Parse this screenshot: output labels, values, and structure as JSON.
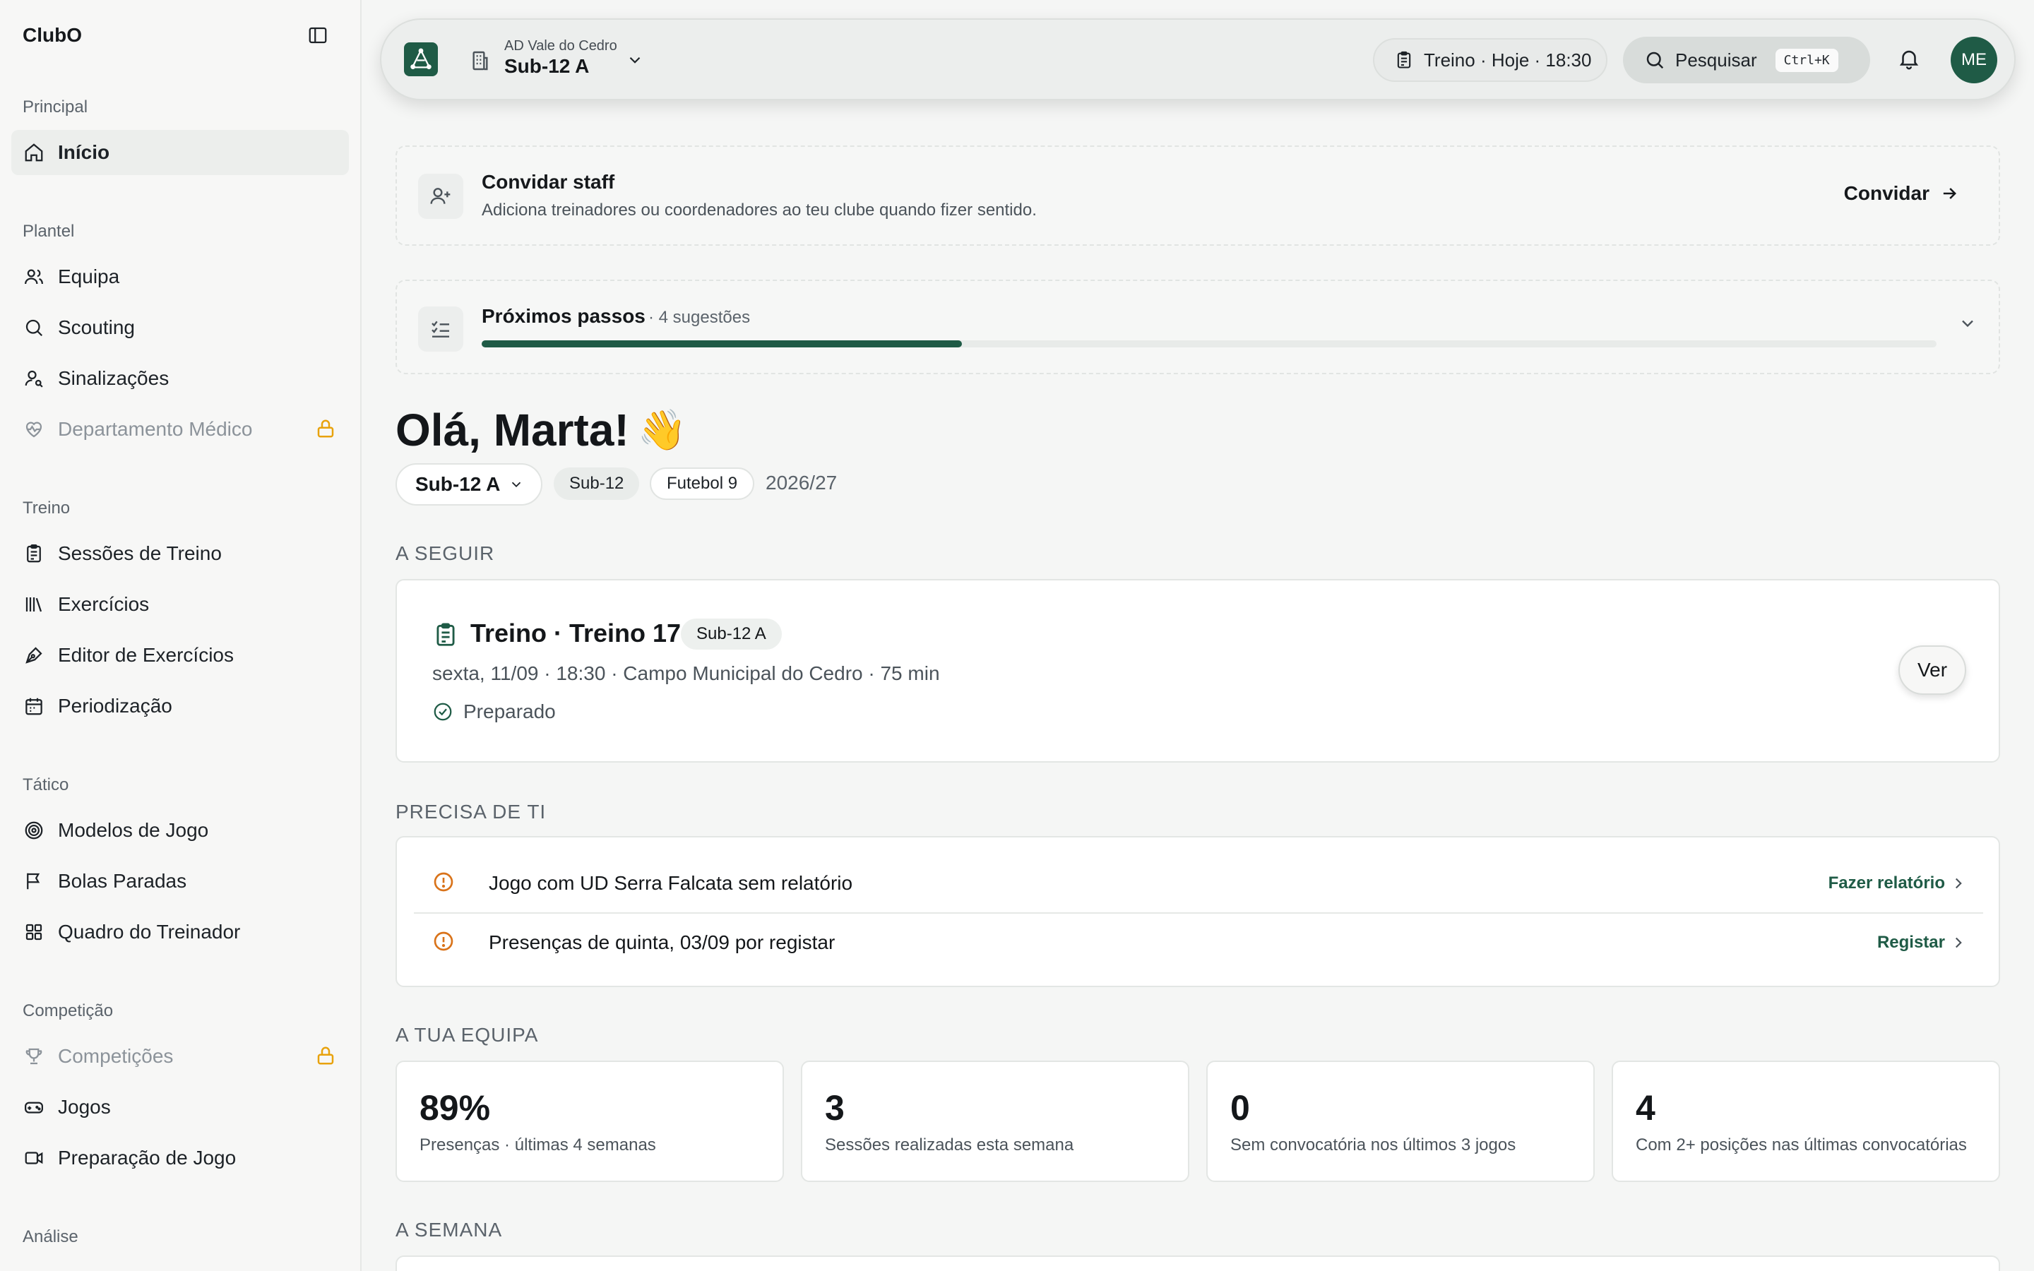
{
  "sidebar": {
    "brand": "ClubO",
    "sections": [
      {
        "label": "Principal"
      },
      {
        "label": "Plantel"
      },
      {
        "label": "Treino"
      },
      {
        "label": "Tático"
      },
      {
        "label": "Competição"
      },
      {
        "label": "Análise"
      }
    ],
    "items": [
      {
        "label": "Início",
        "icon": "home-icon",
        "active": true
      },
      {
        "label": "Equipa",
        "icon": "users-icon"
      },
      {
        "label": "Scouting",
        "icon": "search-icon"
      },
      {
        "label": "Sinalizações",
        "icon": "user-search-icon"
      },
      {
        "label": "Departamento Médico",
        "icon": "heart-pulse-icon",
        "locked": true
      },
      {
        "label": "Sessões de Treino",
        "icon": "clipboard-icon"
      },
      {
        "label": "Exercícios",
        "icon": "library-icon"
      },
      {
        "label": "Editor de Exercícios",
        "icon": "pen-tool-icon"
      },
      {
        "label": "Periodização",
        "icon": "calendar-icon"
      },
      {
        "label": "Modelos de Jogo",
        "icon": "target-icon"
      },
      {
        "label": "Bolas Paradas",
        "icon": "flag-icon"
      },
      {
        "label": "Quadro do Treinador",
        "icon": "grid-icon"
      },
      {
        "label": "Competições",
        "icon": "trophy-icon",
        "locked": true
      },
      {
        "label": "Jogos",
        "icon": "gamepad-icon"
      },
      {
        "label": "Preparação de Jogo",
        "icon": "video-icon"
      }
    ]
  },
  "topbar": {
    "club_name": "AD Vale do Cedro",
    "team": "Sub-12 A",
    "session_pill": "Treino · Hoje · 18:30",
    "search_label": "Pesquisar",
    "search_shortcut": "Ctrl+K",
    "avatar_initials": "ME"
  },
  "invite": {
    "title": "Convidar staff",
    "description": "Adiciona treinadores ou coordenadores ao teu clube quando fizer sentido.",
    "action": "Convidar"
  },
  "next_steps": {
    "title": "Próximos passos",
    "count": "· 4 sugestões",
    "progress": 0.33
  },
  "greeting": {
    "text": "Olá, Marta!",
    "emoji": "👋"
  },
  "team_bar": {
    "team": "Sub-12 A",
    "tags": [
      "Sub-12",
      "Futebol 9"
    ],
    "season": "2026/27"
  },
  "sections": {
    "up_next": "A SEGUIR",
    "needs_you": "PRECISA DE TI",
    "your_team": "A TUA EQUIPA",
    "week": "A SEMANA"
  },
  "next_session": {
    "title": "Treino · Treino 17",
    "badge": "Sub-12 A",
    "meta": "sexta, 11/09 · 18:30 · Campo Municipal do Cedro · 75 min",
    "status": "Preparado",
    "action": "Ver"
  },
  "needs": [
    {
      "text": "Jogo com UD Serra Falcata sem relatório",
      "action": "Fazer relatório"
    },
    {
      "text": "Presenças de quinta, 03/09 por registar",
      "action": "Registar"
    }
  ],
  "stats": [
    {
      "value": "89%",
      "label": "Presenças · últimas 4 semanas"
    },
    {
      "value": "3",
      "label": "Sessões realizadas esta semana"
    },
    {
      "value": "0",
      "label": "Sem convocatória nos últimos 3 jogos"
    },
    {
      "value": "4",
      "label": "Com 2+ posições nas últimas convocatórias"
    }
  ],
  "colors": {
    "brand": "#1f5b46",
    "lock": "#e8a20c",
    "warning": "#d9731a"
  }
}
